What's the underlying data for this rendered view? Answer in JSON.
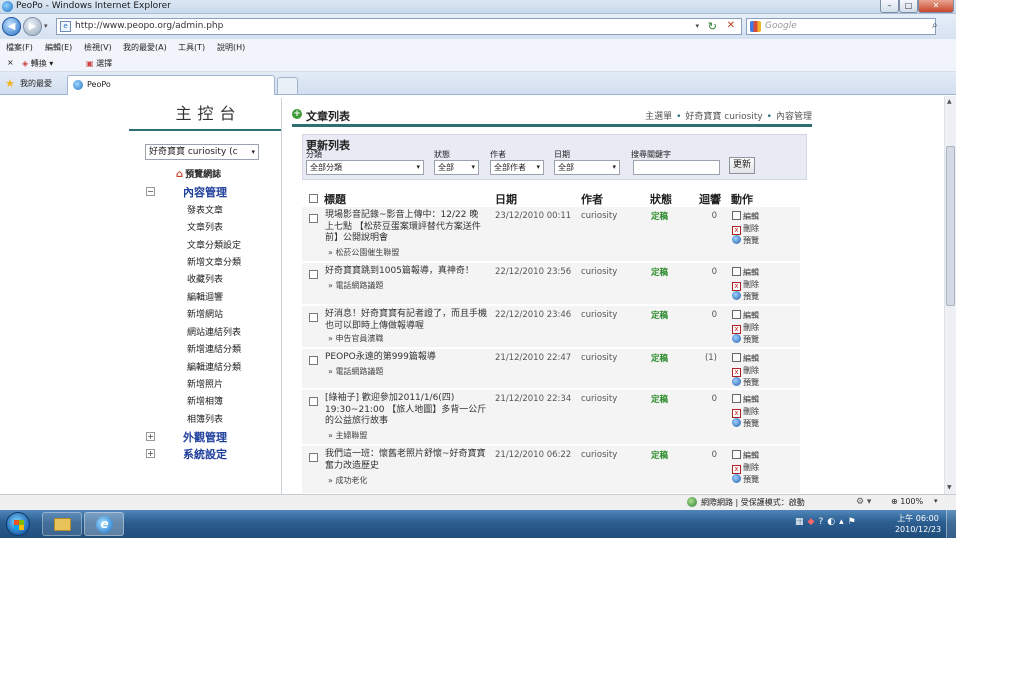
{
  "window": {
    "title": "PeoPo - Windows Internet Explorer",
    "min": "–",
    "max": "□",
    "close": "✕"
  },
  "address": {
    "url": "http://www.peopo.org/admin.php",
    "search_placeholder": "Google"
  },
  "menu": [
    "檔案(F)",
    "編輯(E)",
    "檢視(V)",
    "我的最愛(A)",
    "工具(T)",
    "說明(H)"
  ],
  "toolbar": {
    "close": "×",
    "convert": "轉換",
    "select": "選擇"
  },
  "tabs": {
    "favorites": "我的最愛",
    "active": "PeoPo"
  },
  "sidebar": {
    "title": "主控台",
    "blog_select": "好奇寶寶 curiosity (c",
    "preview_blog": "預覽網誌",
    "sections": [
      {
        "label": "內容管理",
        "toggle": "−"
      },
      {
        "label": "外觀管理",
        "toggle": "+"
      },
      {
        "label": "系統設定",
        "toggle": "+"
      }
    ],
    "items": [
      "發表文章",
      "文章列表",
      "文章分類設定",
      "新增文章分類",
      "收藏列表",
      "編輯迴響",
      "新增網站",
      "網站連結列表",
      "新增連結分類",
      "編輯連結分類",
      "新增照片",
      "新增相簿",
      "相簿列表"
    ]
  },
  "main": {
    "title": "文章列表",
    "breadcrumb": [
      "主選單",
      "好奇寶寶 curiosity",
      "內容管理"
    ],
    "filter": {
      "title": "更新列表",
      "category_label": "分類",
      "category_value": "全部分類",
      "status_label": "狀態",
      "status_value": "全部",
      "author_label": "作者",
      "author_value": "全部作者",
      "date_label": "日期",
      "date_value": "全部",
      "keyword_label": "搜尋關鍵字",
      "update_button": "更新"
    },
    "columns": {
      "title": "標題",
      "date": "日期",
      "author": "作者",
      "status": "狀態",
      "replies": "迴響",
      "actions": "動作"
    },
    "actions": {
      "edit": "編輯",
      "delete": "刪除",
      "preview": "預覽"
    },
    "rows": [
      {
        "title": "現場影音記錄~影音上傳中：12/22 晚上七點 【松菸豆蛋案環評替代方案送件前】公開說明會",
        "category": "» 松菸公園催生聯盟",
        "date": "23/12/2010 00:11",
        "author": "curiosity",
        "status": "定稿",
        "replies": "0"
      },
      {
        "title": "好奇寶寶跳到1005篇報導，真神奇！",
        "category": "» 電話網路議題",
        "date": "22/12/2010 23:56",
        "author": "curiosity",
        "status": "定稿",
        "replies": "0"
      },
      {
        "title": "好消息！好奇寶寶有記者證了，而且手機也可以即時上傳做報導喔",
        "category": "» 申告官員濱職",
        "date": "22/12/2010 23:46",
        "author": "curiosity",
        "status": "定稿",
        "replies": "0"
      },
      {
        "title": "PEOPO永遠的第999篇報導",
        "category": "» 電話網路議題",
        "date": "21/12/2010 22:47",
        "author": "curiosity",
        "status": "定稿",
        "replies": "(1)"
      },
      {
        "title": "[綠袖子] 歡迎參加2011/1/6(四) 19:30~21:00 【旅人地圖】多背一公斤的公益旅行故事",
        "category": "» 主婦聯盟",
        "date": "21/12/2010 22:34",
        "author": "curiosity",
        "status": "定稿",
        "replies": "0"
      },
      {
        "title": "我們這一班：懷舊老照片舒懷~好奇寶寶奮力改造歷史",
        "category": "» 成功老化",
        "date": "21/12/2010 06:22",
        "author": "curiosity",
        "status": "定稿",
        "replies": "0"
      }
    ]
  },
  "status": {
    "zone": "網際網路 | 受保護模式：啟動",
    "zoom": "100%"
  },
  "taskbar": {
    "time": "上午 06:00",
    "date": "2010/12/23"
  },
  "colors": {
    "accent": "#2d6f73",
    "nav_blue": "#1f3f9c",
    "status_green": "#2a8a2a"
  }
}
